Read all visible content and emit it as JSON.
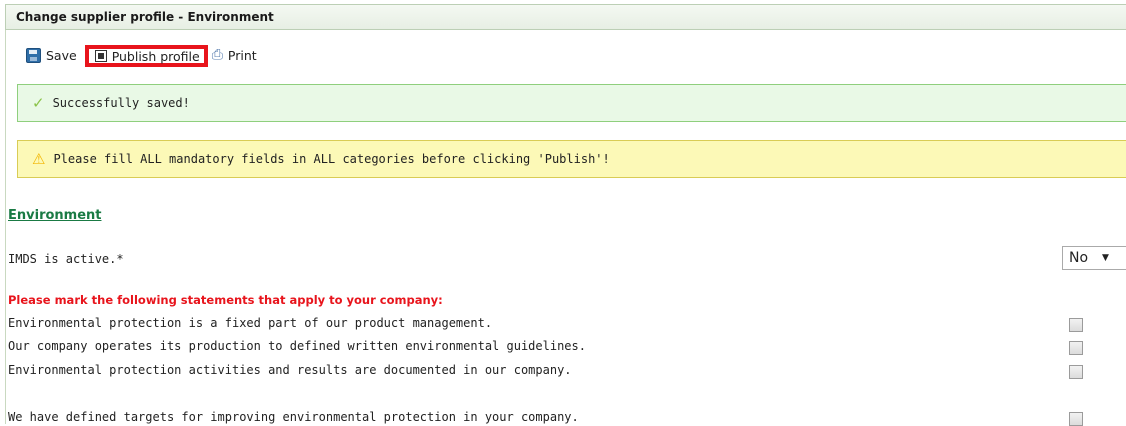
{
  "header": {
    "title": "Change supplier profile - Environment"
  },
  "toolbar": {
    "save_label": "Save",
    "publish_label": "Publish profile",
    "print_label": "Print"
  },
  "messages": {
    "success": "Successfully saved!",
    "warning": "Please fill ALL mandatory fields in ALL categories before clicking 'Publish'!"
  },
  "section": {
    "title": "Environment"
  },
  "imds": {
    "label": "IMDS is active.*",
    "value": "No"
  },
  "statements": {
    "heading": "Please mark the following statements that apply to your company:",
    "items": [
      {
        "text": "Environmental protection is a fixed part of our product management.",
        "checked": false
      },
      {
        "text": "Our company operates its production to defined written environmental guidelines.",
        "checked": false
      },
      {
        "text": "Environmental protection activities and results are documented in our company.",
        "checked": false
      },
      {
        "text": "We have defined targets for improving environmental protection in your company.",
        "checked": false
      }
    ]
  },
  "icons": {
    "save": "save-icon",
    "publish": "publish-icon",
    "print": "print-icon",
    "success": "checkmark-icon",
    "warning": "warning-icon"
  },
  "colors": {
    "highlight": "#e8141c",
    "section_title": "#1a7a44",
    "success_bg": "#e9f9e6",
    "warning_bg": "#fcf9b7",
    "statements_heading": "#e8141c"
  }
}
